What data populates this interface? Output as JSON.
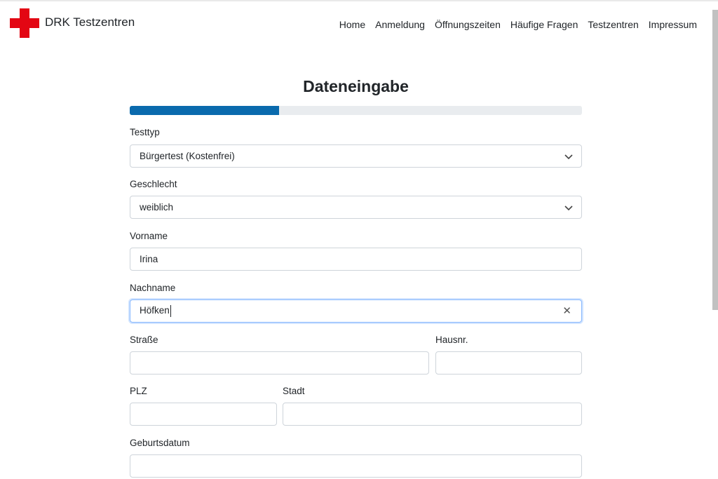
{
  "brand": {
    "name": "DRK Testzentren"
  },
  "nav": {
    "items": [
      "Home",
      "Anmeldung",
      "Öffnungszeiten",
      "Häufige Fragen",
      "Testzentren",
      "Impressum"
    ]
  },
  "form": {
    "title": "Dateneingabe",
    "progress_percent": 33,
    "fields": {
      "testtyp": {
        "label": "Testtyp",
        "value": "Bürgertest (Kostenfrei)"
      },
      "geschlecht": {
        "label": "Geschlecht",
        "value": "weiblich"
      },
      "vorname": {
        "label": "Vorname",
        "value": "Irina"
      },
      "nachname": {
        "label": "Nachname",
        "value": "Höfken"
      },
      "strasse": {
        "label": "Straße",
        "value": ""
      },
      "hausnr": {
        "label": "Hausnr.",
        "value": ""
      },
      "plz": {
        "label": "PLZ",
        "value": ""
      },
      "stadt": {
        "label": "Stadt",
        "value": ""
      },
      "geburtsdatum": {
        "label": "Geburtsdatum",
        "value": ""
      }
    }
  },
  "colors": {
    "brand_red": "#e30613",
    "progress_fill": "#0a6aad",
    "progress_track": "#e9ecef",
    "focus_border": "#86b7fe"
  },
  "icons": {
    "logo": "red-cross-icon",
    "select": "chevron-down-icon",
    "clear": "clear-x-icon"
  }
}
